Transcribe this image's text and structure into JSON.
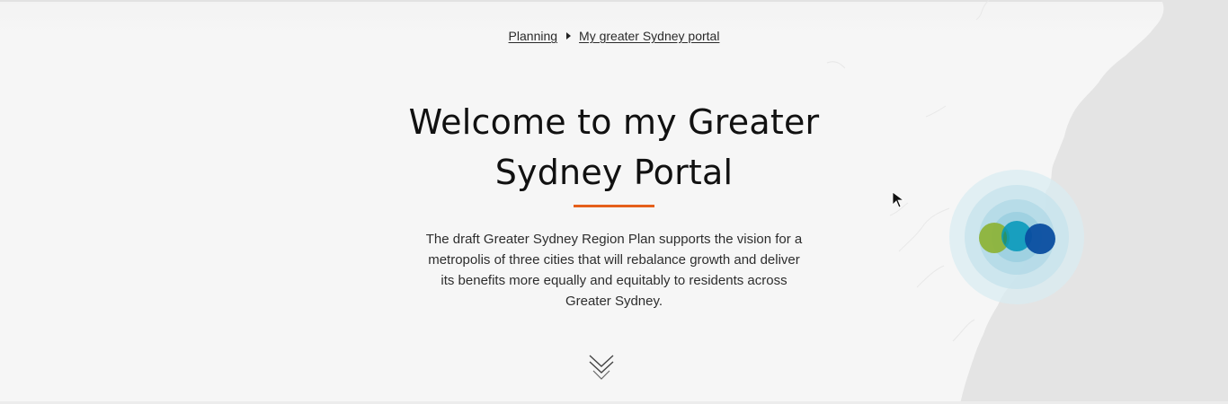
{
  "breadcrumb": {
    "items": [
      "Planning",
      "My greater Sydney portal"
    ]
  },
  "hero": {
    "title_line1": "Welcome to my Greater",
    "title_line2": "Sydney Portal",
    "lead": "The draft Greater Sydney Region Plan supports the vision for a metropolis of three cities that will rebalance growth and deliver its benefits more equally and equitably to residents across Greater Sydney."
  },
  "icons": {
    "breadcrumb_separator": "caret-right-icon",
    "scroll": "double-chevron-down-icon",
    "logo": "three-cities-logo",
    "pointer": "mouse-pointer-icon"
  },
  "colors": {
    "accent": "#e5601b",
    "city_green": "#8db33a",
    "city_teal": "#0096b8",
    "city_blue": "#0a4ea0",
    "map_land": "#e4e4e4",
    "background": "#f5f5f5"
  }
}
